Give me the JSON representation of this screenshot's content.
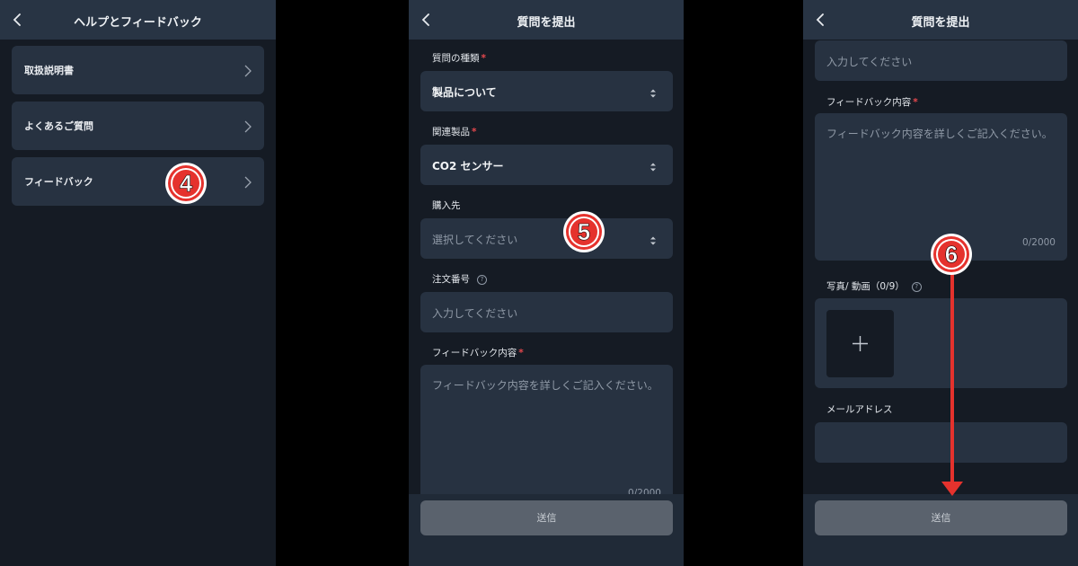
{
  "panel1": {
    "title": "ヘルプとフィードバック",
    "items": [
      {
        "label": "取扱説明書"
      },
      {
        "label": "よくあるご質問"
      },
      {
        "label": "フィードバック"
      }
    ]
  },
  "panel2": {
    "title": "質問を提出",
    "question_type": {
      "label": "質問の種類",
      "value": "製品について"
    },
    "related_product": {
      "label": "関連製品",
      "value": "CO2 センサー"
    },
    "purchase_place": {
      "label": "購入先",
      "placeholder": "選択してください"
    },
    "order_number": {
      "label": "注文番号",
      "placeholder": "入力してください"
    },
    "feedback": {
      "label": "フィードバック内容",
      "placeholder": "フィードバック内容を詳しくご記入ください。",
      "counter": "0/2000"
    },
    "submit_label": "送信"
  },
  "panel3": {
    "title": "質問を提出",
    "order_number_placeholder": "入力してください",
    "feedback": {
      "label": "フィードバック内容",
      "placeholder": "フィードバック内容を詳しくご記入ください。",
      "counter": "0/2000"
    },
    "photo_label": "写真/ 動画（0/9）",
    "email_label": "メールアドレス",
    "submit_label": "送信"
  },
  "annotations": {
    "step4": "4",
    "step5": "5",
    "step6": "6",
    "badge_color": "#e5322d",
    "arrow_color": "#e5322d"
  },
  "required_mark": "*"
}
